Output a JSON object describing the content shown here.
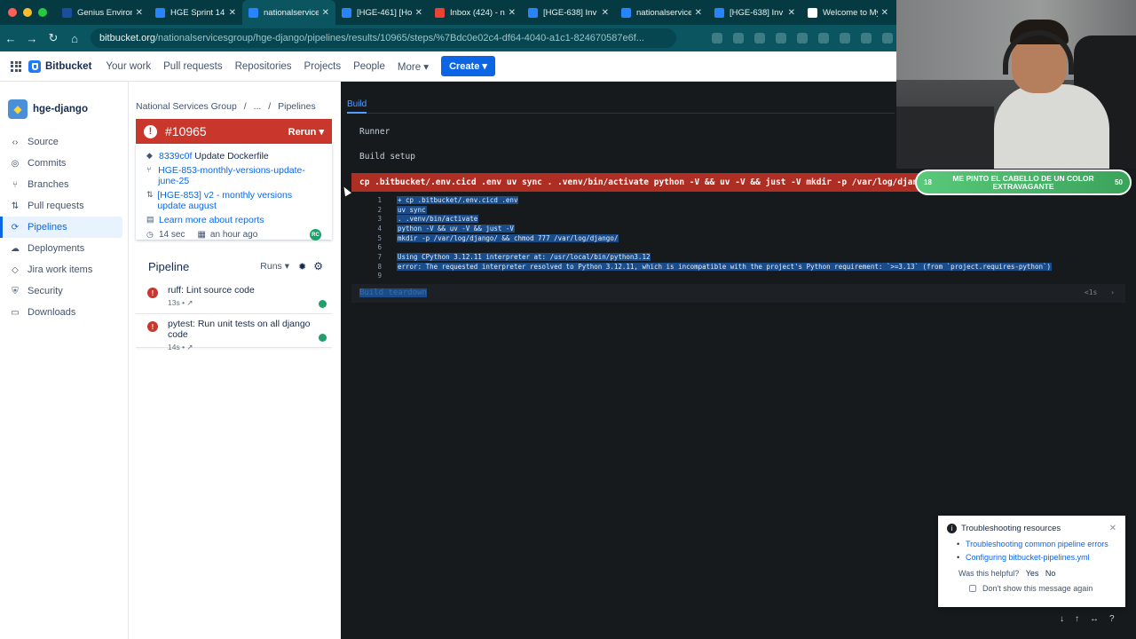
{
  "browser": {
    "tabs": [
      {
        "title": "Genius Environ",
        "icon": "genius-icon",
        "color": "#1c4e9d",
        "active": false
      },
      {
        "title": "HGE Sprint 14",
        "icon": "jira-icon",
        "color": "#2684ff",
        "active": false
      },
      {
        "title": "nationalservice",
        "icon": "bitbucket-icon",
        "color": "#2684ff",
        "active": true
      },
      {
        "title": "[HGE-461] [Ho",
        "icon": "jira-icon",
        "color": "#2684ff",
        "active": false
      },
      {
        "title": "Inbox (424) - n",
        "icon": "gmail-icon",
        "color": "#ea4335",
        "active": false
      },
      {
        "title": "[HGE-638] Inv",
        "icon": "jira-icon",
        "color": "#2684ff",
        "active": false
      },
      {
        "title": "nationalservice",
        "icon": "bitbucket-icon",
        "color": "#2684ff",
        "active": false
      },
      {
        "title": "[HGE-638] Inv",
        "icon": "jira-icon",
        "color": "#2684ff",
        "active": false
      },
      {
        "title": "Welcome to My",
        "icon": "page-icon",
        "color": "#ffffff",
        "active": false
      }
    ],
    "url_host": "bitbucket.org",
    "url_path": "/nationalservicesgroup/hge-django/pipelines/results/10965/steps/%7Bdc0e02c4-df64-4040-a1c1-824670587e6f..."
  },
  "header": {
    "brand": "Bitbucket",
    "nav": [
      "Your work",
      "Pull requests",
      "Repositories",
      "Projects",
      "People",
      "More"
    ],
    "create": "Create"
  },
  "sidebar": {
    "repo": "hge-django",
    "items": [
      {
        "label": "Source",
        "icon": "source-icon",
        "active": false
      },
      {
        "label": "Commits",
        "icon": "commits-icon",
        "active": false
      },
      {
        "label": "Branches",
        "icon": "branches-icon",
        "active": false
      },
      {
        "label": "Pull requests",
        "icon": "pull-requests-icon",
        "active": false
      },
      {
        "label": "Pipelines",
        "icon": "pipelines-icon",
        "active": true
      },
      {
        "label": "Deployments",
        "icon": "deployments-icon",
        "active": false
      },
      {
        "label": "Jira work items",
        "icon": "jira-items-icon",
        "active": false
      },
      {
        "label": "Security",
        "icon": "security-icon",
        "active": false
      },
      {
        "label": "Downloads",
        "icon": "downloads-icon",
        "active": false
      }
    ]
  },
  "breadcrumb": {
    "org": "National Services Group",
    "sep": "/",
    "ellipsis": "...",
    "page": "Pipelines"
  },
  "run": {
    "number": "#10965",
    "rerun": "Rerun",
    "commit_hash": "8339c0f",
    "commit_msg": "Update Dockerfile",
    "branch": "HGE-853-monthly-versions-update-june-25",
    "pr": "[HGE-853] v2 - monthly versions update august",
    "reports_link": "Learn more about reports",
    "duration": "14 sec",
    "when": "an hour ago",
    "avatar": "RC"
  },
  "pipeline": {
    "title": "Pipeline",
    "runs_label": "Runs",
    "steps": [
      {
        "name": "ruff: Lint source code",
        "meta": "13s • ↗"
      },
      {
        "name": "pytest: Run unit tests on all django code",
        "meta": "14s • ↗"
      }
    ]
  },
  "log": {
    "tab": "Build",
    "runner": "Runner",
    "setup": "Build setup",
    "command": "cp .bitbucket/.env.cicd .env uv sync . .venv/bin/activate python -V && uv -V && just -V mkdir -p /var/log/django/ && chmod 777 /var/log/django/",
    "lines": [
      {
        "n": "1",
        "text": "+ cp .bitbucket/.env.cicd .env"
      },
      {
        "n": "2",
        "text": "uv sync"
      },
      {
        "n": "3",
        "text": ". .venv/bin/activate"
      },
      {
        "n": "4",
        "text": "python -V && uv -V && just -V"
      },
      {
        "n": "5",
        "text": "mkdir -p /var/log/django/ && chmod 777 /var/log/django/"
      },
      {
        "n": "6",
        "text": ""
      },
      {
        "n": "7",
        "text": "Using CPython 3.12.11 interpreter at: /usr/local/bin/python3.12"
      },
      {
        "n": "8",
        "text": "error: The requested interpreter resolved to Python 3.12.11, which is incompatible with the project's Python requirement: `>=3.13` (from `project.requires-python`)"
      },
      {
        "n": "9",
        "text": ""
      }
    ],
    "teardown": "Build teardown",
    "teardown_time": "<1s"
  },
  "overlay": {
    "left_num": "18",
    "message": "ME PINTO EL CABELLO DE UN COLOR EXTRAVAGANTE",
    "right_num": "50"
  },
  "popup": {
    "title": "Troubleshooting resources",
    "links": [
      "Troubleshooting common pipeline errors",
      "Configuring bitbucket-pipelines.yml"
    ],
    "helpful": "Was this helpful?",
    "yes": "Yes",
    "no": "No",
    "dont_show": "Don't show this message again"
  },
  "colors": {
    "accent": "#0c66e4",
    "error": "#c9372c",
    "log_bg": "#161a1d",
    "browser": "#0b5561"
  }
}
